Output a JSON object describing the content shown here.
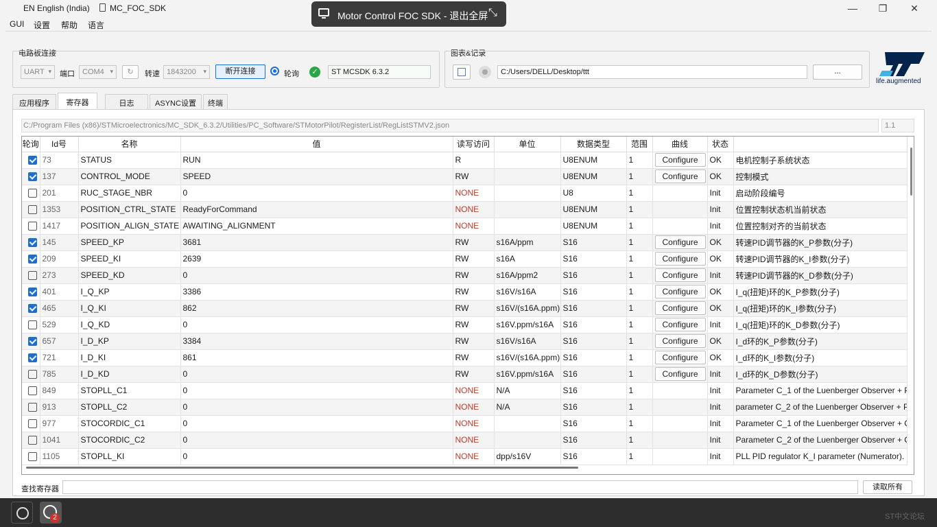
{
  "titlebar": {
    "language": "EN English (India)",
    "app_title": "MC_FOC_SDK",
    "minimize": "—",
    "restore": "❐",
    "close": "✕"
  },
  "fullscreen_banner": {
    "text": "Motor Control FOC SDK - 退出全屏"
  },
  "menu": [
    "GUI",
    "设置",
    "帮助",
    "语言"
  ],
  "connection": {
    "group_title": "电路板连接",
    "interface": "UART",
    "port_label": "端口",
    "port": "COM4",
    "speed_label": "转速",
    "baud": "1843200",
    "disconnect_label": "断开连接",
    "poll_label": "轮询",
    "sdk_version": "ST MCSDK 6.3.2"
  },
  "logging": {
    "group_title": "图表&记录",
    "path": "C:/Users/DELL/Desktop/ttt",
    "browse_label": "..."
  },
  "brand": {
    "tagline": "life.augmented",
    "color": "#03234b",
    "accent": "#3cb4e6"
  },
  "tabs": [
    "应用程序",
    "寄存器",
    "日志",
    "ASYNC设置",
    "终端"
  ],
  "active_tab": 1,
  "register_file": {
    "path": "C:/Program Files (x86)/STMicroelectronics/MC_SDK_6.3.2/Utilities/PC_Software/STMotorPilot/RegisterList/RegListSTMV2.json",
    "version": "1.1"
  },
  "table": {
    "headers": [
      "轮询",
      "Id号",
      "名称",
      "值",
      "读写访问",
      "单位",
      "数据类型",
      "范围",
      "曲线",
      "状态",
      ""
    ],
    "configure_label": "Configure",
    "rows": [
      {
        "poll": true,
        "id": "73",
        "name": "STATUS",
        "value": "RUN",
        "access": "R",
        "unit": "",
        "type": "U8ENUM",
        "range": "1",
        "curve": true,
        "status": "OK",
        "desc": "电机控制子系统状态"
      },
      {
        "poll": true,
        "id": "137",
        "name": "CONTROL_MODE",
        "value": "SPEED",
        "access": "RW",
        "unit": "",
        "type": "U8ENUM",
        "range": "1",
        "curve": true,
        "status": "OK",
        "desc": "控制模式"
      },
      {
        "poll": false,
        "id": "201",
        "name": "RUC_STAGE_NBR",
        "value": "0",
        "access": "NONE",
        "unit": "",
        "type": "U8",
        "range": "1",
        "curve": false,
        "status": "Init",
        "desc": "启动阶段编号"
      },
      {
        "poll": false,
        "id": "1353",
        "name": "POSITION_CTRL_STATE",
        "value": "ReadyForCommand",
        "access": "NONE",
        "unit": "",
        "type": "U8ENUM",
        "range": "1",
        "curve": false,
        "status": "Init",
        "desc": "位置控制状态机当前状态"
      },
      {
        "poll": false,
        "id": "1417",
        "name": "POSITION_ALIGN_STATE",
        "value": "AWAITING_ALIGNMENT",
        "access": "NONE",
        "unit": "",
        "type": "U8ENUM",
        "range": "1",
        "curve": false,
        "status": "Init",
        "desc": "位置控制对齐的当前状态"
      },
      {
        "poll": true,
        "id": "145",
        "name": "SPEED_KP",
        "value": "3681",
        "access": "RW",
        "unit": "s16A/ppm",
        "type": "S16",
        "range": "1",
        "curve": true,
        "status": "OK",
        "desc": "转速PID调节器的K_P参数(分子)"
      },
      {
        "poll": true,
        "id": "209",
        "name": "SPEED_KI",
        "value": "2639",
        "access": "RW",
        "unit": "s16A",
        "type": "S16",
        "range": "1",
        "curve": true,
        "status": "OK",
        "desc": "转速PID调节器的K_I参数(分子)"
      },
      {
        "poll": false,
        "id": "273",
        "name": "SPEED_KD",
        "value": "0",
        "access": "RW",
        "unit": "s16A/ppm2",
        "type": "S16",
        "range": "1",
        "curve": true,
        "status": "Init",
        "desc": "转速PID调节器的K_D参数(分子)"
      },
      {
        "poll": true,
        "id": "401",
        "name": "I_Q_KP",
        "value": "3386",
        "access": "RW",
        "unit": "s16V/s16A",
        "type": "S16",
        "range": "1",
        "curve": true,
        "status": "OK",
        "desc": "I_q(扭矩)环的K_P参数(分子)"
      },
      {
        "poll": true,
        "id": "465",
        "name": "I_Q_KI",
        "value": "862",
        "access": "RW",
        "unit": "s16V/(s16A.ppm)",
        "type": "S16",
        "range": "1",
        "curve": true,
        "status": "OK",
        "desc": "I_q(扭矩)环的K_I参数(分子)"
      },
      {
        "poll": false,
        "id": "529",
        "name": "I_Q_KD",
        "value": "0",
        "access": "RW",
        "unit": "s16V.ppm/s16A",
        "type": "S16",
        "range": "1",
        "curve": true,
        "status": "Init",
        "desc": "I_q(扭矩)环的K_D参数(分子)"
      },
      {
        "poll": true,
        "id": "657",
        "name": "I_D_KP",
        "value": "3384",
        "access": "RW",
        "unit": "s16V/s16A",
        "type": "S16",
        "range": "1",
        "curve": true,
        "status": "OK",
        "desc": "I_d环的K_P参数(分子)"
      },
      {
        "poll": true,
        "id": "721",
        "name": "I_D_KI",
        "value": "861",
        "access": "RW",
        "unit": "s16V/(s16A.ppm)",
        "type": "S16",
        "range": "1",
        "curve": true,
        "status": "OK",
        "desc": "I_d环的K_I参数(分子)"
      },
      {
        "poll": false,
        "id": "785",
        "name": "I_D_KD",
        "value": "0",
        "access": "RW",
        "unit": "s16V.ppm/s16A",
        "type": "S16",
        "range": "1",
        "curve": true,
        "status": "Init",
        "desc": "I_d环的K_D参数(分子)"
      },
      {
        "poll": false,
        "id": "849",
        "name": "STOPLL_C1",
        "value": "0",
        "access": "NONE",
        "unit": "N/A",
        "type": "S16",
        "range": "1",
        "curve": false,
        "status": "Init",
        "desc": "Parameter C_1 of the Luenberger Observer + P"
      },
      {
        "poll": false,
        "id": "913",
        "name": "STOPLL_C2",
        "value": "0",
        "access": "NONE",
        "unit": "N/A",
        "type": "S16",
        "range": "1",
        "curve": false,
        "status": "Init",
        "desc": "parameter C_2 of the Luenberger Observer + P"
      },
      {
        "poll": false,
        "id": "977",
        "name": "STOCORDIC_C1",
        "value": "0",
        "access": "NONE",
        "unit": "",
        "type": "S16",
        "range": "1",
        "curve": false,
        "status": "Init",
        "desc": "Parameter C_1 of the Luenberger Observer + C"
      },
      {
        "poll": false,
        "id": "1041",
        "name": "STOCORDIC_C2",
        "value": "0",
        "access": "NONE",
        "unit": "",
        "type": "S16",
        "range": "1",
        "curve": false,
        "status": "Init",
        "desc": "Parameter C_2 of the Luenberger Observer + C"
      },
      {
        "poll": false,
        "id": "1105",
        "name": "STOPLL_KI",
        "value": "0",
        "access": "NONE",
        "unit": "dpp/s16V",
        "type": "S16",
        "range": "1",
        "curve": false,
        "status": "Init",
        "desc": "PLL PID regulator K_I parameter (Numerator)."
      }
    ]
  },
  "search": {
    "label": "查找寄存器",
    "value": "",
    "read_all_label": "读取所有"
  },
  "taskbar": {
    "badge": "2",
    "watermark": "ST中文论坛"
  }
}
